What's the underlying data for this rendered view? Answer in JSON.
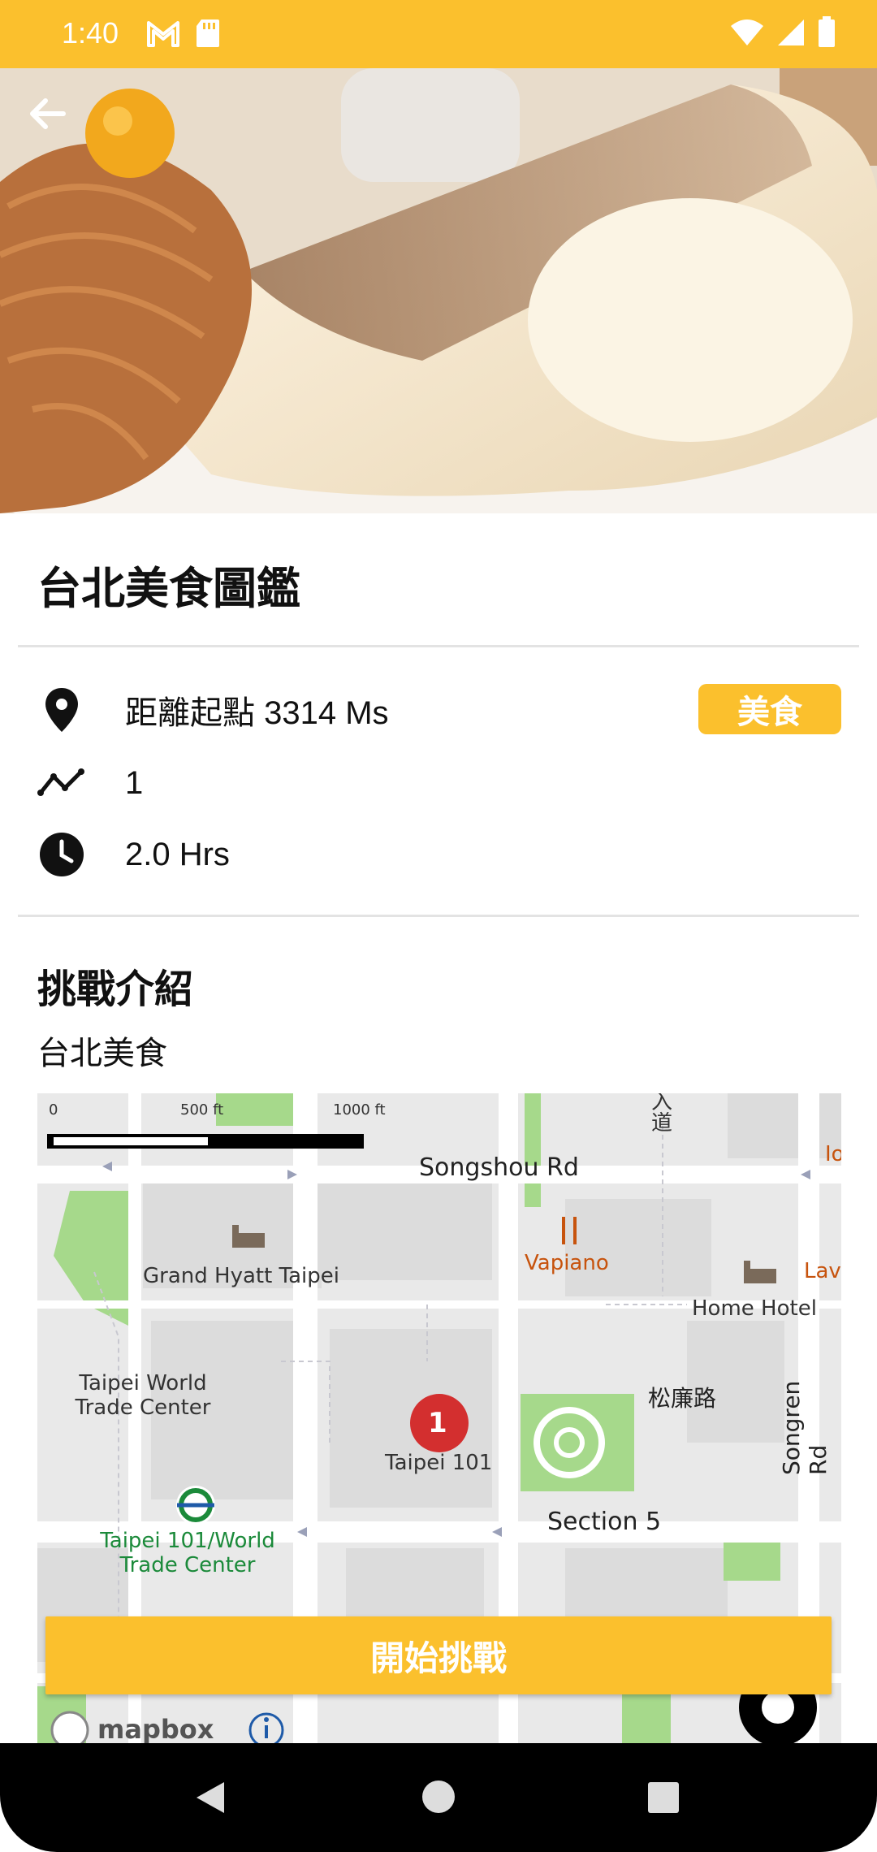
{
  "status_bar": {
    "time": "1:40",
    "color": "#FBC02D",
    "icons_left": [
      "gmail-icon",
      "sd-card-icon"
    ],
    "icons_right": [
      "wifi-icon",
      "signal-icon",
      "battery-icon"
    ]
  },
  "hero": {
    "image_description_icon": "food-photo",
    "back_icon": "arrow-back-icon"
  },
  "challenge": {
    "title": "台北美食圖鑑",
    "distance": "距離起點 3314 Ms",
    "tag": "美食",
    "checkpoints": "1",
    "duration": "2.0 Hrs",
    "section_title": "挑戰介紹",
    "description": "台北美食"
  },
  "map": {
    "scale_labels": [
      "0",
      "500 ft",
      "1000 ft"
    ],
    "streets": [
      "Songshou Rd",
      "Section 5",
      "Songren Rd"
    ],
    "places": [
      "Grand Hyatt Taipei",
      "Vapiano",
      "Home Hotel",
      "松廉路",
      "Taipei World Trade Center",
      "Taipei 101",
      "Taipei 101/World Trade Center",
      "入道",
      "Lav",
      "Io"
    ],
    "marker_number": "1",
    "attribution": "mapbox"
  },
  "actions": {
    "start_label": "開始挑戰"
  },
  "colors": {
    "accent": "#FBC02D",
    "marker": "#D32F2F",
    "metro_green": "#1B8A3A"
  }
}
